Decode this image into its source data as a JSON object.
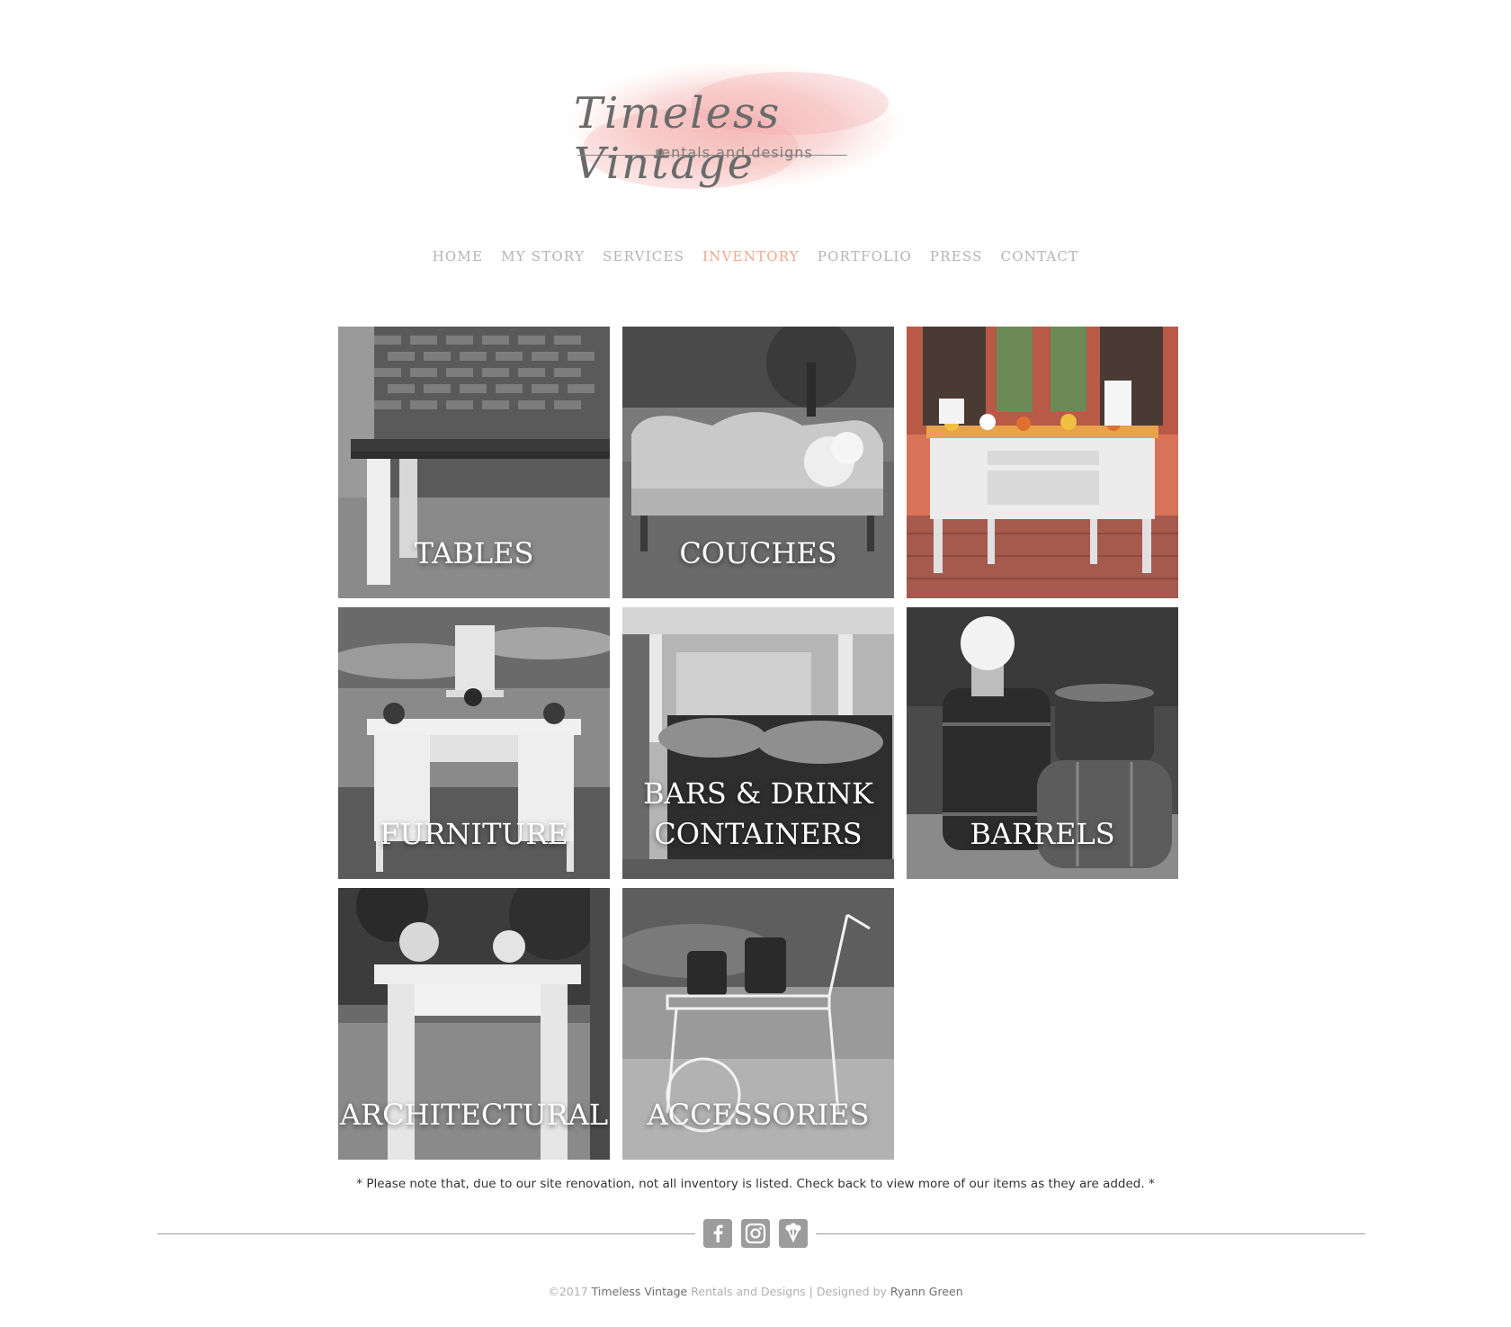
{
  "logo": {
    "title": "Timeless Vintage",
    "subtitle": "rentals and designs"
  },
  "nav": {
    "items": [
      {
        "label": "HOME",
        "active": false
      },
      {
        "label": "MY STORY",
        "active": false
      },
      {
        "label": "SERVICES",
        "active": false
      },
      {
        "label": "INVENTORY",
        "active": true
      },
      {
        "label": "PORTFOLIO",
        "active": false
      },
      {
        "label": "PRESS",
        "active": false
      },
      {
        "label": "CONTACT",
        "active": false
      }
    ],
    "active_color": "#f0a88a",
    "inactive_color": "#b4b4b4"
  },
  "inventory": {
    "tiles": [
      {
        "line1": "TABLES",
        "line2": ""
      },
      {
        "line1": "COUCHES",
        "line2": ""
      },
      {
        "line1": "",
        "line2": ""
      },
      {
        "line1": "FURNITURE",
        "line2": ""
      },
      {
        "line1": "BARS & DRINK",
        "line2": "CONTAINERS"
      },
      {
        "line1": "BARRELS",
        "line2": ""
      },
      {
        "line1": "ARCHITECTURAL",
        "line2": ""
      },
      {
        "line1": "ACCESSORIES",
        "line2": ""
      }
    ]
  },
  "note": "* Please note that, due to our site renovation, not all inventory is listed. Check back to view more of our items as they are added. *",
  "social": {
    "icons": [
      "facebook-icon",
      "instagram-icon",
      "weddingwire-icon"
    ],
    "glyphs": [
      "f",
      "◎",
      "❦"
    ]
  },
  "footer": {
    "year": "©2017",
    "brand": "Timeless Vintage",
    "brand_suffix": "Rentals and Designs | Designed by",
    "designer": "Ryann Green"
  }
}
